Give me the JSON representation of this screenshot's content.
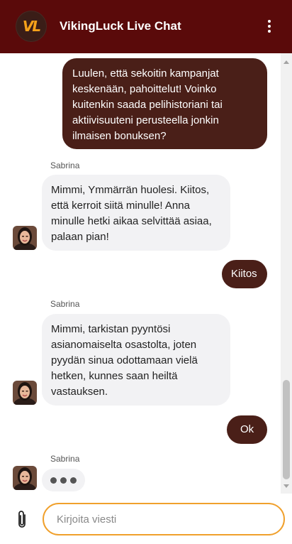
{
  "header": {
    "logo_text": "VL",
    "title": "VikingLuck Live Chat",
    "menu_icon": "kebab-menu-icon"
  },
  "messages": [
    {
      "from": "user",
      "text": "Luulen, että sekoitin kampanjat keskenään, pahoittelut! Voinko kuitenkin saada pelihistoriani tai aktiivisuuteni perusteella jonkin ilmaisen bonuksen?"
    },
    {
      "from": "agent",
      "sender": "Sabrina",
      "text": "Mimmi, Ymmärrän huolesi. Kiitos, että kerroit siitä minulle! Anna minulle hetki aikaa selvittää asiaa, palaan pian!"
    },
    {
      "from": "user",
      "text": "Kiitos"
    },
    {
      "from": "agent",
      "sender": "Sabrina",
      "text": "Mimmi, tarkistan pyyntösi asianomaiselta osastolta, joten pyydän sinua odottamaan vielä hetken, kunnes saan heiltä vastauksen."
    },
    {
      "from": "user",
      "text": "Ok"
    },
    {
      "from": "agent",
      "sender": "Sabrina",
      "typing": true
    }
  ],
  "composer": {
    "placeholder": "Kirjoita viesti",
    "value": "",
    "attach_icon": "paperclip-icon"
  },
  "colors": {
    "header_bg": "#5a0a0a",
    "user_bubble": "#4a1f18",
    "agent_bubble": "#f2f2f4",
    "input_border": "#f0a02c",
    "logo_accent": "#f5a01a"
  }
}
